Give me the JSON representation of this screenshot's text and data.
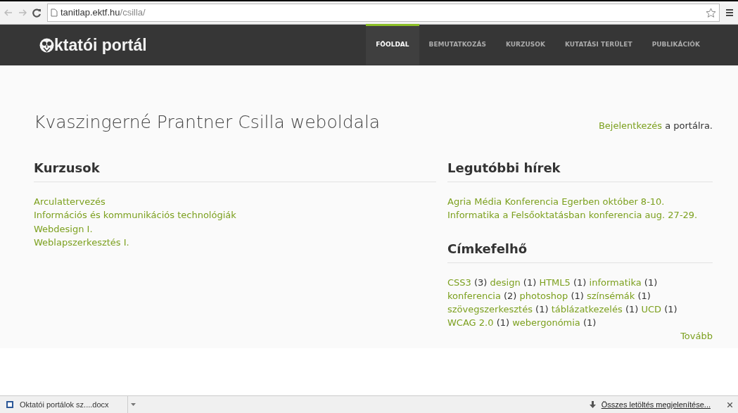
{
  "browser": {
    "url_host": "tanitlap.ektf.hu",
    "url_path": "/csilla/"
  },
  "site": {
    "logo_text": "ktatói portál",
    "nav": [
      {
        "label": "FŐOLDAL",
        "selected": true
      },
      {
        "label": "BEMUTATKOZÁS",
        "selected": false
      },
      {
        "label": "KURZUSOK",
        "selected": false
      },
      {
        "label": "KUTATÁSI TERÜLET",
        "selected": false
      },
      {
        "label": "PUBLIKÁCIÓK",
        "selected": false
      }
    ]
  },
  "page_title": "Kvaszingerné Prantner Csilla weboldala",
  "login": {
    "link": "Bejelentkezés",
    "text": "a portálra."
  },
  "courses": {
    "heading": "Kurzusok",
    "items": [
      "Arculattervezés",
      "Információs és kommunikációs technológiák",
      "Webdesign I.",
      "Weblapszerkesztés I."
    ]
  },
  "news": {
    "heading": "Legutóbbi hírek",
    "items": [
      "Agria Média Konferencia Egerben október 8-10.",
      "Informatika a Felsőoktatásban konferencia aug. 27-29."
    ]
  },
  "tag_cloud": {
    "heading": "Címkefelhő",
    "more": "Tovább",
    "tags": [
      {
        "name": "CSS3",
        "count": "(3)"
      },
      {
        "name": "design",
        "count": "(1)"
      },
      {
        "name": "HTML5",
        "count": "(1)"
      },
      {
        "name": "informatika",
        "count": "(1)"
      },
      {
        "name": "konferencia",
        "count": "(2)"
      },
      {
        "name": "photoshop",
        "count": "(1)"
      },
      {
        "name": "színsémák",
        "count": "(1)"
      },
      {
        "name": "szövegszerkesztés",
        "count": "(1)"
      },
      {
        "name": "táblázatkezelés",
        "count": "(1)"
      },
      {
        "name": "UCD",
        "count": "(1)"
      },
      {
        "name": "WCAG 2.0",
        "count": "(1)"
      },
      {
        "name": "webergonómia",
        "count": "(1)"
      }
    ]
  },
  "download_bar": {
    "file": "Oktatói portálok sz....docx",
    "show_all": "Összes letöltés megjelenítése..."
  }
}
